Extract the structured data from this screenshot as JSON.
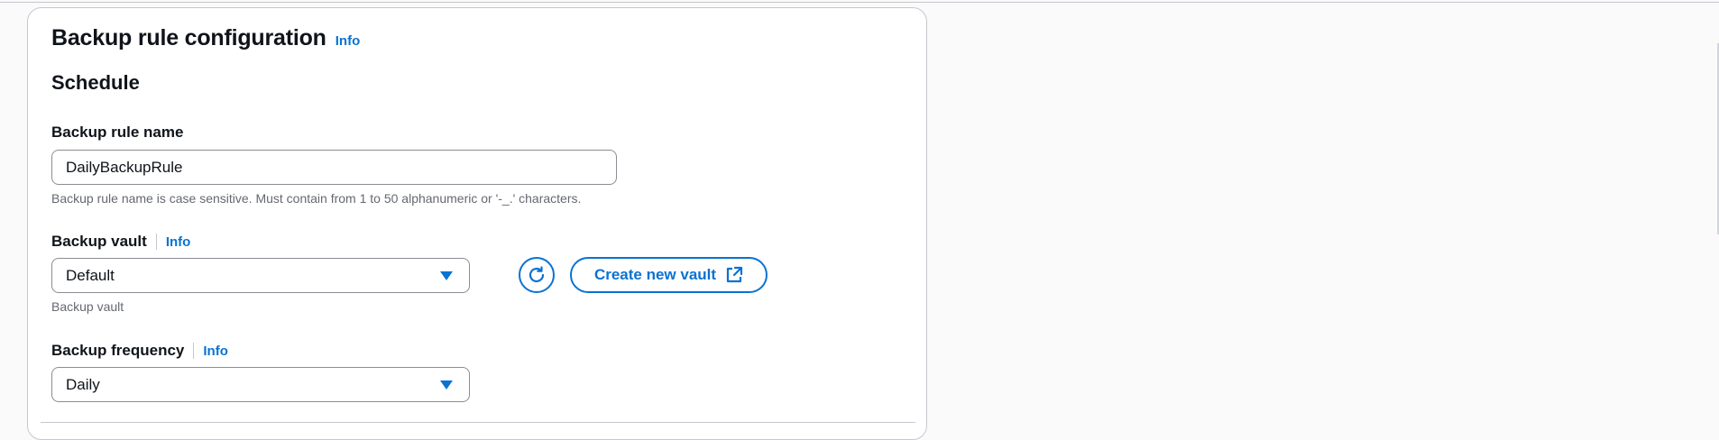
{
  "card": {
    "title": "Backup rule configuration",
    "info": "Info"
  },
  "schedule": {
    "title": "Schedule"
  },
  "rule_name": {
    "label": "Backup rule name",
    "value": "DailyBackupRule",
    "hint": "Backup rule name is case sensitive. Must contain from 1 to 50 alphanumeric or '-_.' characters."
  },
  "vault": {
    "label": "Backup vault",
    "info": "Info",
    "selected": "Default",
    "hint": "Backup vault",
    "create_label": "Create new vault",
    "refresh_icon": "refresh-icon",
    "external_icon": "external-link-icon"
  },
  "frequency": {
    "label": "Backup frequency",
    "info": "Info",
    "selected": "Daily"
  },
  "colors": {
    "accent": "#0972d3",
    "text": "#0f141a",
    "hint": "#656871",
    "border": "#8c8c94"
  }
}
